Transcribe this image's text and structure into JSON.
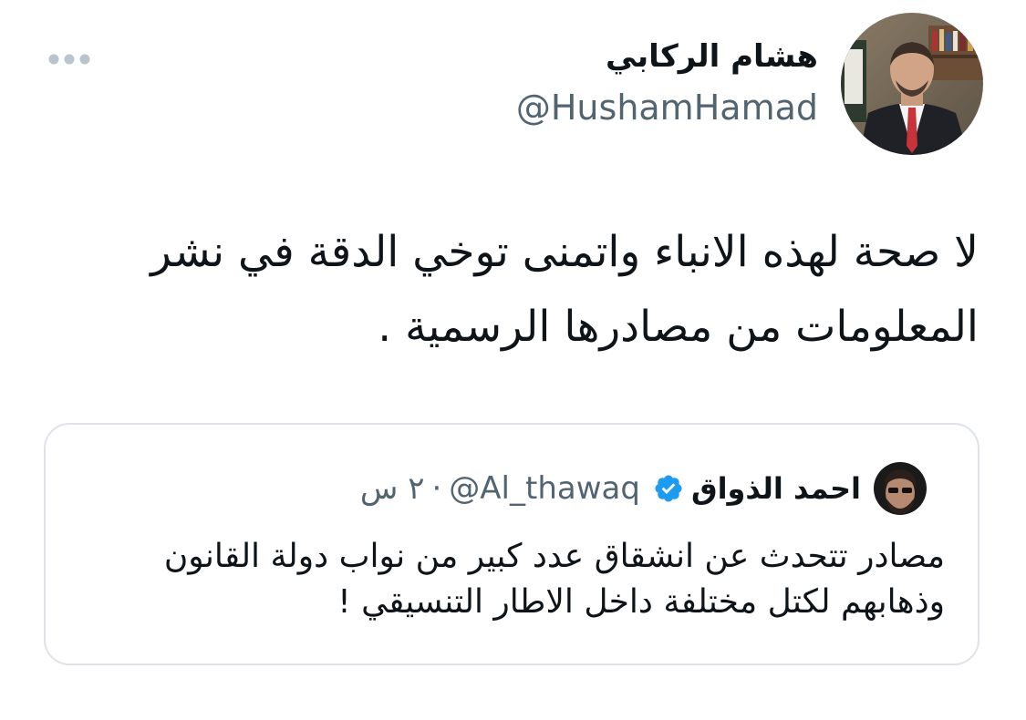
{
  "tweet": {
    "author_name": "هشام الركابي",
    "author_handle": "@HushamHamad",
    "text": "لا صحة لهذه الانباء واتمنى توخي الدقة في نشر المعلومات من مصادرها الرسمية .",
    "more_icon": "more-dots-icon"
  },
  "quoted_tweet": {
    "author_name": "احمد الذواق",
    "verified_icon": "verified-badge-icon",
    "author_handle": "@Al_thawaq",
    "separator": "·",
    "time": "٢ س",
    "text": "مصادر تتحدث عن انشقاق عدد كبير من نواب دولة القانون وذهابهم لكتل مختلفة داخل الاطار التنسيقي !"
  },
  "colors": {
    "text_primary": "#0f1419",
    "text_secondary": "#536471",
    "verified_blue": "#1d9bf0",
    "card_border": "#dfe3e7",
    "more_icon_gray": "#b9c4cd"
  }
}
